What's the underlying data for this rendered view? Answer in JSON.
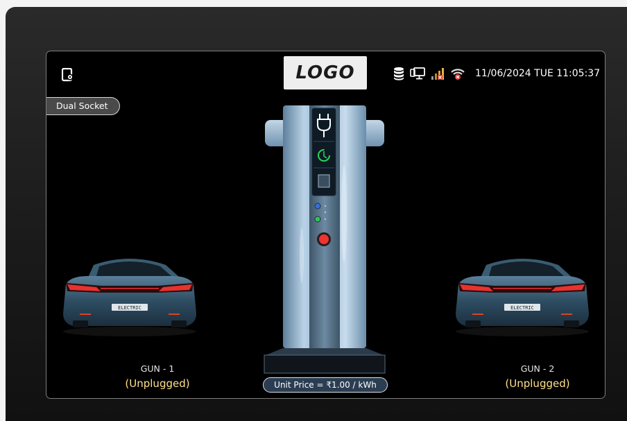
{
  "header": {
    "logo_text": "LOGO",
    "datetime": "11/06/2024 TUE 11:05:37",
    "mode": "Dual Socket"
  },
  "status_icons": [
    "database-icon",
    "network-monitor-icon",
    "signal-bars-icon",
    "wifi-error-icon"
  ],
  "guns": [
    {
      "label": "GUN - 1",
      "status": "(Unplugged)"
    },
    {
      "label": "GUN - 2",
      "status": "(Unplugged)"
    }
  ],
  "car_plate": "ELECTRIC",
  "charger": {
    "unit_price": "Unit Price = ₹1.00 / kWh"
  },
  "colors": {
    "screen_bg": "#000000",
    "status_yellow": "#ffe08a",
    "charger_blue": "#8fb2cf"
  }
}
